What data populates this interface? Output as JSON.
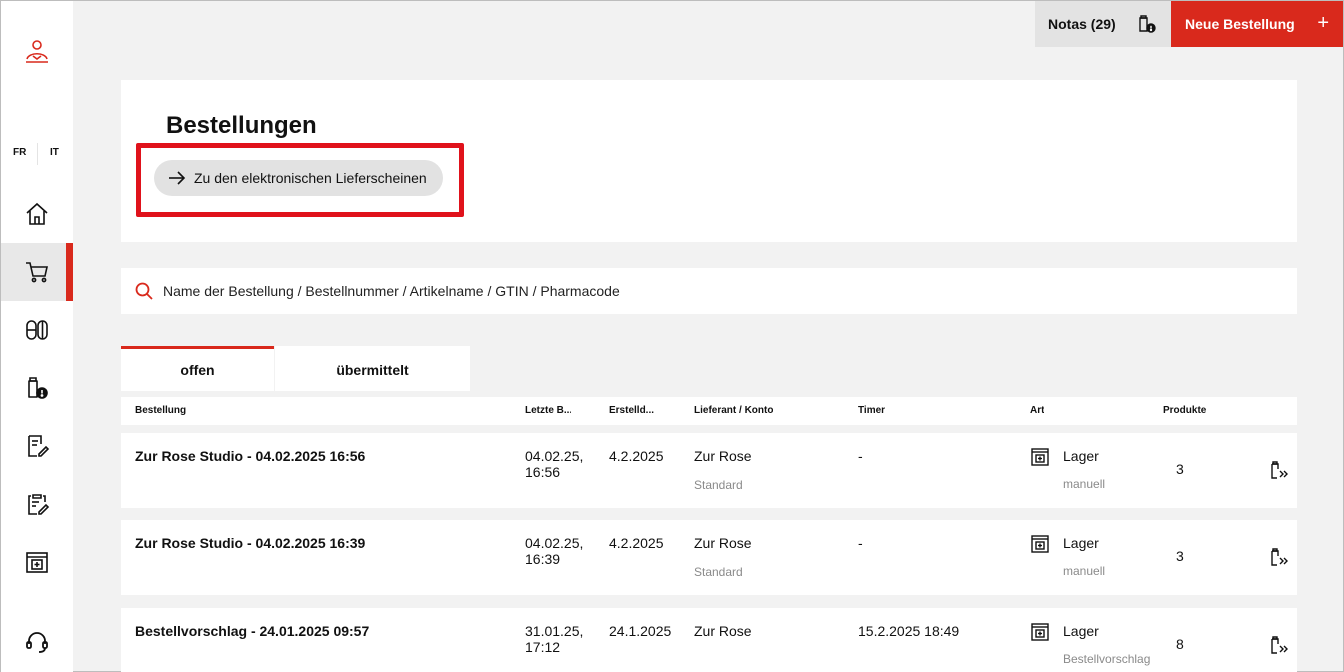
{
  "sidebar": {
    "lang_fr": "FR",
    "lang_it": "IT",
    "items": [
      {
        "icon": "home-icon"
      },
      {
        "icon": "cart-icon",
        "active": true
      },
      {
        "icon": "pills-icon"
      },
      {
        "icon": "medicine-alert-icon"
      },
      {
        "icon": "edit-document-icon"
      },
      {
        "icon": "clipboard-edit-icon"
      },
      {
        "icon": "warehouse-icon"
      },
      {
        "icon": "headset-icon"
      }
    ]
  },
  "topbar": {
    "notas_label": "Notas (29)",
    "new_order_label": "Neue Bestellung",
    "new_order_plus": "+"
  },
  "header": {
    "title": "Bestellungen",
    "link_label": "Zu den elektronischen Lieferscheinen"
  },
  "search": {
    "placeholder": "Name der Bestellung / Bestellnummer / Artikelname / GTIN / Pharmacode"
  },
  "tabs": [
    {
      "label": "offen",
      "active": true
    },
    {
      "label": "übermittelt",
      "active": false
    }
  ],
  "table": {
    "columns": [
      "Bestellung",
      "Letzte B...",
      "Erstelld...",
      "Lieferant / Konto",
      "Timer",
      "Art",
      "Produkte"
    ],
    "rows": [
      {
        "name": "Zur Rose Studio - 04.02.2025 16:56",
        "last_line1": "04.02.25,",
        "last_line2": "16:56",
        "created": "4.2.2025",
        "supplier": "Zur Rose",
        "account": "Standard",
        "timer": "-",
        "art": "Lager",
        "art_sub": "manuell",
        "products": "3"
      },
      {
        "name": "Zur Rose Studio - 04.02.2025 16:39",
        "last_line1": "04.02.25,",
        "last_line2": "16:39",
        "created": "4.2.2025",
        "supplier": "Zur Rose",
        "account": "Standard",
        "timer": "-",
        "art": "Lager",
        "art_sub": "manuell",
        "products": "3"
      },
      {
        "name": "Bestellvorschlag - 24.01.2025 09:57",
        "last_line1": "31.01.25,",
        "last_line2": "17:12",
        "created": "24.1.2025",
        "supplier": "Zur Rose",
        "account": "",
        "timer": "15.2.2025 18:49",
        "art": "Lager",
        "art_sub": "Bestellvorschlag",
        "products": "8"
      }
    ]
  },
  "colors": {
    "accent": "#d9291c",
    "highlight": "#e0121b",
    "background": "#f2f2f2"
  }
}
